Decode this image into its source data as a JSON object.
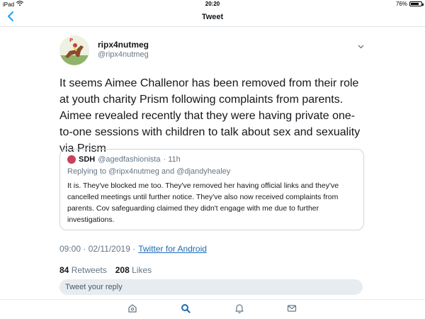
{
  "status_bar": {
    "device": "iPad",
    "time": "20:20",
    "battery_text": "76%",
    "battery_level": 0.76
  },
  "nav": {
    "title": "Tweet",
    "back_icon": "chevron-left-icon"
  },
  "tweet": {
    "author_name": "ripx4nutmeg",
    "author_handle": "@ripx4nutmeg",
    "text": "It seems Aimee Challenor has been removed from their role at youth charity Prism following complaints from parents. Aimee revealed recently that they were having private one-to-one sessions with children to talk about sex and sexuality via Prism",
    "timestamp": "09:00 · 02/11/2019 ·",
    "source": "Twitter for Android",
    "retweets_count": "84",
    "retweets_label": "Retweets",
    "likes_count": "208",
    "likes_label": "Likes"
  },
  "quote": {
    "name": "SDH",
    "handle": "@agedfashionista",
    "age": "· 11h",
    "replying_prefix": "Replying to",
    "reply_to_1": "@ripx4nutmeg",
    "reply_and": "and",
    "reply_to_2": "@djandyhealey",
    "text": "It is. They've blocked me too. They've removed her having official links and they've cancelled meetings until further notice. They've also now received complaints from parents. Cov safeguarding claimed they didn't engage with me due to further investigations."
  },
  "reply": {
    "placeholder": "Tweet your reply"
  },
  "tab_bar": {
    "items": [
      "home-icon",
      "search-icon",
      "notifications-icon",
      "messages-icon"
    ],
    "active": "search-icon"
  },
  "colors": {
    "accent": "#1da1f2",
    "link": "#1b6bb5",
    "muted": "#657786"
  }
}
